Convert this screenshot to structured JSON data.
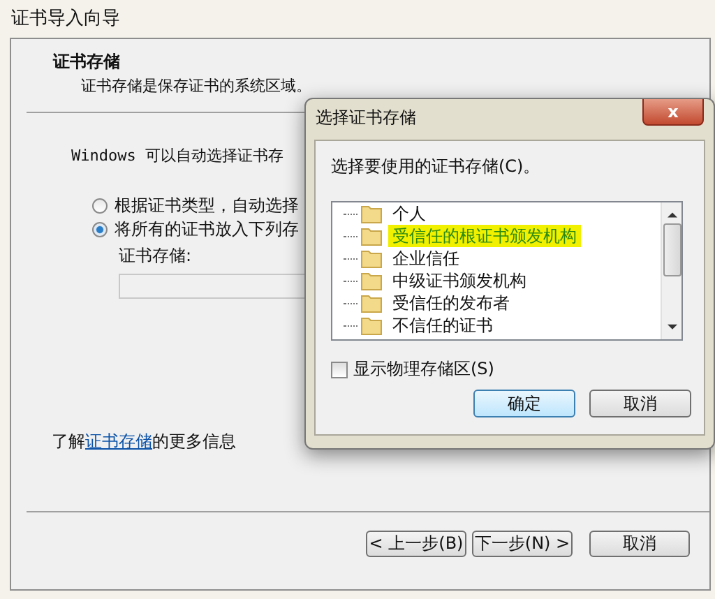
{
  "window": {
    "title": "证书导入向导"
  },
  "header": {
    "title": "证书存储",
    "subtitle": "证书存储是保存证书的系统区域。"
  },
  "intro": "Windows 可以自动选择证书存",
  "options": [
    {
      "label": "根据证书类型，自动选择",
      "selected": false
    },
    {
      "label": "将所有的证书放入下列存",
      "selected": true
    }
  ],
  "store_label": "证书存储:",
  "more_info": {
    "prefix": "了解",
    "link": "证书存储",
    "suffix": "的更多信息"
  },
  "buttons": [
    "< 上一步(B)",
    "下一步(N) >",
    "取消"
  ],
  "dialog": {
    "title": "选择证书存储",
    "close": "x",
    "prompt": "选择要使用的证书存储(C)。",
    "stores": [
      {
        "label": "个人",
        "selected": false
      },
      {
        "label": "受信任的根证书颁发机构",
        "selected": true
      },
      {
        "label": "企业信任",
        "selected": false
      },
      {
        "label": "中级证书颁发机构",
        "selected": false
      },
      {
        "label": "受信任的发布者",
        "selected": false
      },
      {
        "label": "不信任的证书",
        "selected": false
      }
    ],
    "show_physical": {
      "label": "显示物理存储区(S)",
      "checked": false
    },
    "buttons": [
      "确定",
      "取消"
    ]
  }
}
